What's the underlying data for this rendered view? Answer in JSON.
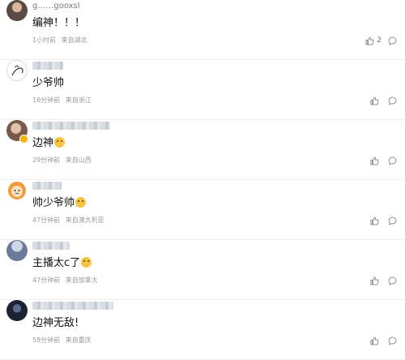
{
  "comments": [
    {
      "username": "g……gooxsl",
      "text": "编神！！！",
      "time": "1小时前",
      "location": "来自湖北",
      "likes": "2",
      "avatar": "photo"
    },
    {
      "username": "",
      "text": "少爷帅",
      "time": "16分钟前",
      "location": "来自浙江",
      "likes": "",
      "avatar": "sketch"
    },
    {
      "username": "",
      "text": "边神",
      "text_emoji": "grinning-face-emoji",
      "time": "29分钟前",
      "location": "来自山西",
      "likes": "",
      "avatar": "photo",
      "vip_badge": true
    },
    {
      "username": "",
      "text": "帅少爷帅",
      "text_emoji": "crying-laughing-emoji",
      "time": "47分钟前",
      "location": "来自澳大利亚",
      "likes": "",
      "avatar": "orange-emoji"
    },
    {
      "username": "",
      "text": "主播太c了",
      "text_emoji": "grinning-face-emoji",
      "time": "47分钟前",
      "location": "来自加拿大",
      "likes": "",
      "avatar": "photo"
    },
    {
      "username": "",
      "text": "边神无敌!",
      "time": "58分钟前",
      "location": "来自重庆",
      "likes": "",
      "avatar": "dark-photo"
    }
  ],
  "icons": {
    "like": "thumbs-up-icon",
    "reply": "comment-bubble-icon"
  },
  "colors": {
    "text": "#111111",
    "meta": "#999999",
    "divider": "#efefef"
  }
}
